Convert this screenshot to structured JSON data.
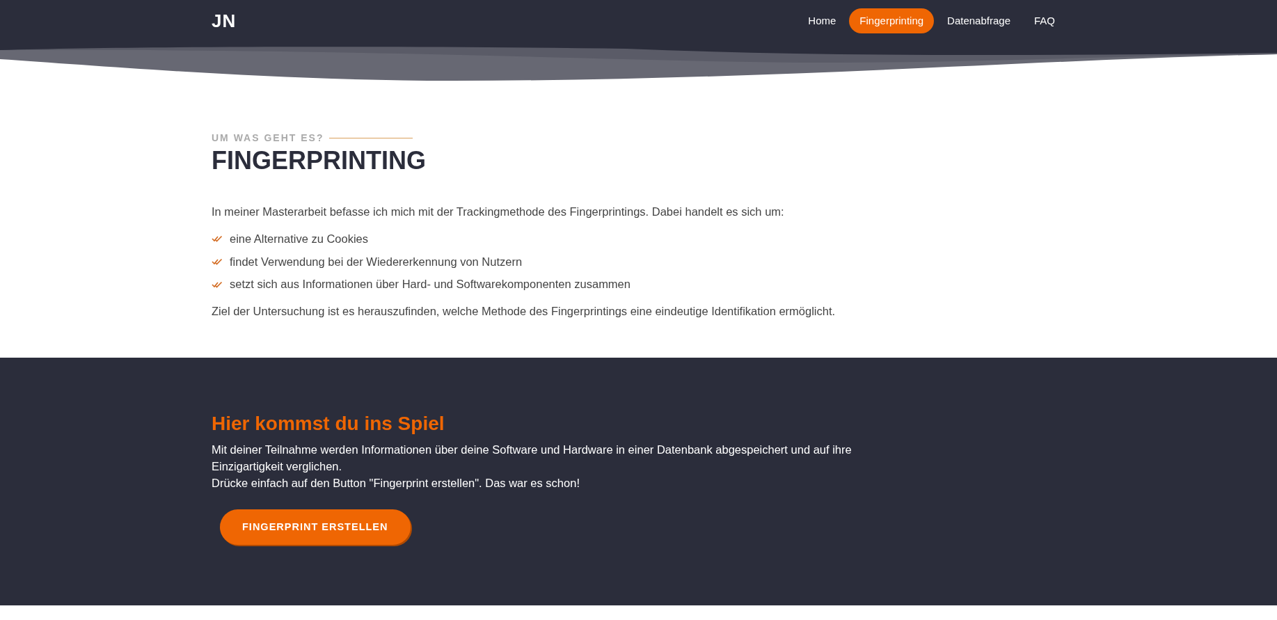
{
  "header": {
    "logo": "JN",
    "nav": [
      {
        "label": "Home",
        "selected": false
      },
      {
        "label": "Fingerprinting",
        "selected": true
      },
      {
        "label": "Datenabfrage",
        "selected": false
      },
      {
        "label": "FAQ",
        "selected": false
      }
    ]
  },
  "about": {
    "eyebrow": "UM WAS GEHT ES?",
    "title": "FINGERPRINTING",
    "intro": "In meiner Masterarbeit befasse ich mich mit der Trackingmethode des Fingerprintings. Dabei handelt es sich um:",
    "bullets": [
      "eine Alternative zu Cookies",
      "findet Verwendung bei der Wiedererkennung von Nutzern",
      "setzt sich aus Informationen über Hard- und Softwarekomponenten zusammen"
    ],
    "outro": "Ziel der Untersuchung ist es herauszufinden, welche Methode des Fingerprintings eine eindeutige Identifikation ermöglicht."
  },
  "cta": {
    "title": "Hier kommst du ins Spiel",
    "paragraphs": [
      "Mit deiner Teilnahme werden Informationen über deine Software und Hardware in einer Datenbank abgespeichert und auf ihre Einzigartigkeit verglichen.",
      "Drücke einfach auf den Button \"Fingerprint erstellen\". Das war es schon!"
    ],
    "button": "FINGERPRINT ERSTELLEN"
  }
}
